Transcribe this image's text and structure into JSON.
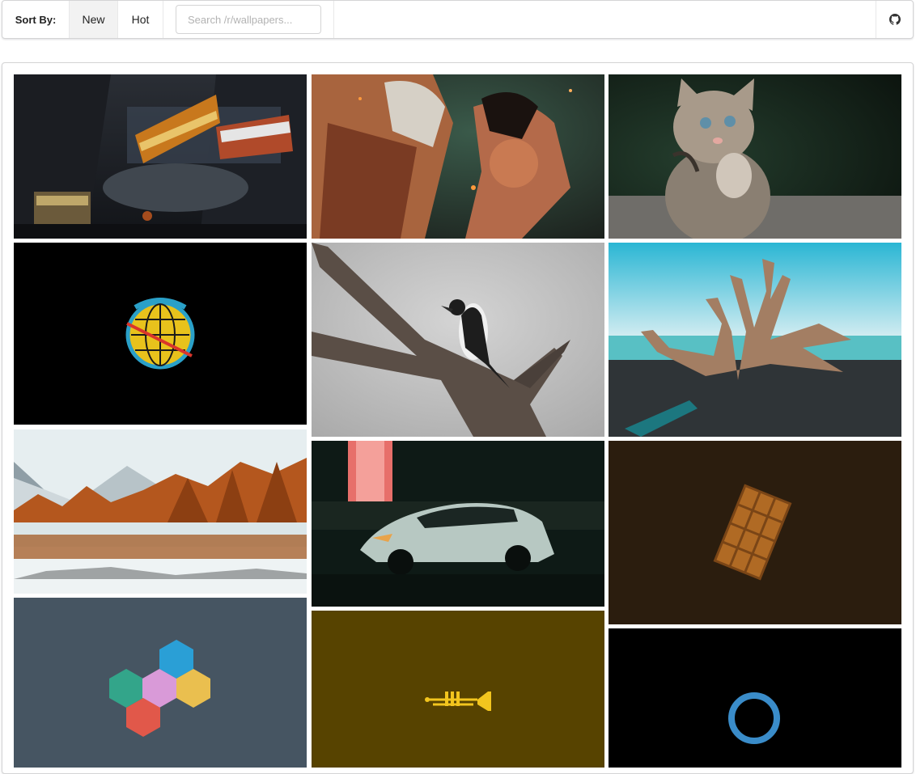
{
  "toolbar": {
    "sort_label": "Sort By:",
    "options": [
      "New",
      "Hot"
    ],
    "selected": "New",
    "search_placeholder": "Search /r/wallpapers...",
    "search_value": ""
  },
  "gallery": {
    "items": [
      {
        "subject": "mechanical trains in industrial hangar"
      },
      {
        "subject": "anime titan battle"
      },
      {
        "subject": "kitten with raised paws"
      },
      {
        "subject": "Space Jam logo on black"
      },
      {
        "subject": "kingfisher on dead branch"
      },
      {
        "subject": "driftwood tree on turquoise beach"
      },
      {
        "subject": "autumn forest lake with snow"
      },
      {
        "subject": "sports car at night"
      },
      {
        "subject": "chocolate bar on dark brown"
      },
      {
        "subject": "colored hexagons on slate"
      },
      {
        "subject": "trumpet on olive"
      },
      {
        "subject": "blue ring on black"
      }
    ]
  },
  "colors": {
    "accent_blue": "#3a8cc9",
    "slate": "#465562",
    "olive": "#574300",
    "chocolate_bg": "#2b1d0e"
  },
  "icons": {
    "github": "github-icon"
  }
}
